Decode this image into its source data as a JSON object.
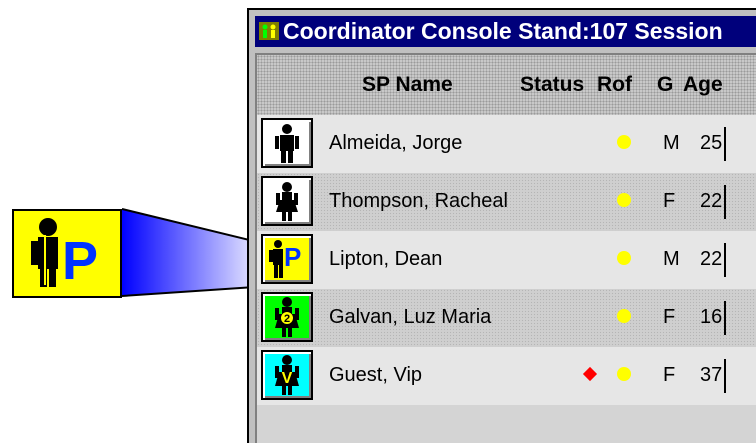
{
  "window": {
    "title": "Coordinator Console Stand:107 Session"
  },
  "columns": {
    "name": "SP Name",
    "status": "Status",
    "rof": "Rof",
    "gender": "G",
    "age": "Age"
  },
  "colors": {
    "title_bar": "#00007b",
    "rof_indicator": "#ffff00",
    "status_indicator": "#ff0000"
  },
  "rows": [
    {
      "name": "Almeida, Jorge",
      "gender": "M",
      "age": "25",
      "icon": "male-figure-icon",
      "icon_bg": "#ffffff",
      "status": "",
      "rof": "yellow"
    },
    {
      "name": "Thompson, Racheal",
      "gender": "F",
      "age": "22",
      "icon": "female-figure-icon",
      "icon_bg": "#ffffff",
      "status": "",
      "rof": "yellow"
    },
    {
      "name": "Lipton, Dean",
      "gender": "M",
      "age": "22",
      "icon": "male-figure-p-badge-icon",
      "icon_bg": "#ffff00",
      "status": "",
      "rof": "yellow"
    },
    {
      "name": "Galvan, Luz Maria",
      "gender": "F",
      "age": "16",
      "icon": "female-figure-2-badge-icon",
      "icon_bg": "#00ff00",
      "status": "",
      "rof": "yellow"
    },
    {
      "name": "Guest, Vip",
      "gender": "F",
      "age": "37",
      "icon": "female-figure-v-badge-icon",
      "icon_bg": "#00ffff",
      "status": "red-diamond",
      "rof": "yellow"
    }
  ],
  "zoom_callout": {
    "icon": "male-figure-p-badge-icon",
    "bg": "#ffff00",
    "letter": "P"
  }
}
